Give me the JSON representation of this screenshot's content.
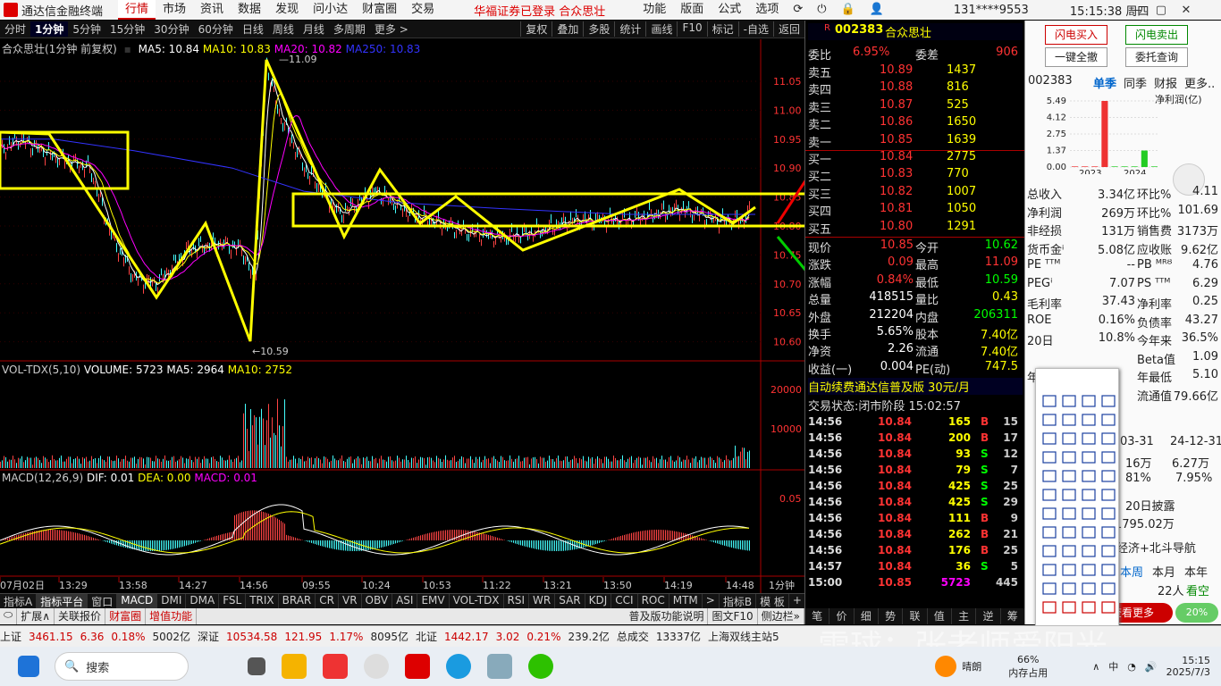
{
  "title_bar": {
    "app_name": "通达信金融终端",
    "menus": [
      "行情",
      "市场",
      "资讯",
      "数据",
      "发现",
      "问小达",
      "财富圈",
      "交易"
    ],
    "active_menu": "行情",
    "notice": "华福证券已登录  合众思壮",
    "right_menus": [
      "功能",
      "版面",
      "公式",
      "选项"
    ],
    "phone": "131****9553",
    "time": "15:15:38 周四"
  },
  "timeframes": [
    "分时",
    "1分钟",
    "5分钟",
    "15分钟",
    "30分钟",
    "60分钟",
    "日线",
    "周线",
    "月线",
    "多周期",
    "更多 >"
  ],
  "active_timeframe": "1分钟",
  "chart_tools": [
    "复权",
    "叠加",
    "多股",
    "统计",
    "画线",
    "F10",
    "标记",
    "-自选",
    "返回"
  ],
  "main_info": {
    "name": "合众思壮(1分钟 前复权)",
    "ma5": "MA5: 10.84",
    "ma10": "MA10: 10.83",
    "ma20": "MA20: 10.82",
    "ma250": "MA250: 10.83"
  },
  "vol_info": {
    "name": "VOL-TDX(5,10)",
    "volume": "VOLUME: 5723",
    "ma5": "MA5: 2964",
    "ma10": "MA10: 2752"
  },
  "macd_info": {
    "name": "MACD(12,26,9)",
    "dif": "DIF: 0.01",
    "dea": "DEA: 0.00",
    "macd": "MACD: 0.01"
  },
  "y_labels": [
    "11.05",
    "11.00",
    "10.95",
    "10.90",
    "10.85",
    "10.80",
    "10.75",
    "10.70",
    "10.65",
    "10.60"
  ],
  "vol_labels": [
    "20000",
    "10000"
  ],
  "macd_labels": [
    "0.05"
  ],
  "x_labels": [
    "07月02日",
    "13:29",
    "13:58",
    "14:27",
    "14:56",
    "09:55",
    "10:24",
    "10:53",
    "11:22",
    "13:21",
    "13:50",
    "14:19",
    "14:48"
  ],
  "high_mark": "11.09",
  "low_mark": "10.59",
  "period_label": "1分钟",
  "indicator_tabs": [
    "指标A",
    "指标平台",
    "窗口",
    "MACD",
    "DMI",
    "DMA",
    "FSL",
    "TRIX",
    "BRAR",
    "CR",
    "VR",
    "OBV",
    "ASI",
    "EMV",
    "VOL-TDX",
    "RSI",
    "WR",
    "SAR",
    "KDJ",
    "CCI",
    "ROC",
    "MTM",
    ">",
    "指标B",
    "模 板",
    "+"
  ],
  "bottom_tabs": [
    "扩展∧",
    "关联报价",
    "财富圈",
    "增值功能"
  ],
  "bottom_right": [
    "普及版功能说明",
    "图文F10",
    "侧边栏»"
  ],
  "quote": {
    "code": "002383",
    "name": "合众思壮",
    "weibi_label": "委比",
    "weibi": "6.95%",
    "weicha_label": "委差",
    "weicha": "906",
    "sell": [
      [
        "卖五",
        "10.89",
        "1437"
      ],
      [
        "卖四",
        "10.88",
        "816"
      ],
      [
        "卖三",
        "10.87",
        "525"
      ],
      [
        "卖二",
        "10.86",
        "1650"
      ],
      [
        "卖一",
        "10.85",
        "1639"
      ]
    ],
    "buy": [
      [
        "买一",
        "10.84",
        "2775"
      ],
      [
        "买二",
        "10.83",
        "770"
      ],
      [
        "买三",
        "10.82",
        "1007"
      ],
      [
        "买四",
        "10.81",
        "1050"
      ],
      [
        "买五",
        "10.80",
        "1291"
      ]
    ],
    "stats": [
      [
        "现价",
        "10.85",
        "今开",
        "10.62"
      ],
      [
        "涨跌",
        "0.09",
        "最高",
        "11.09"
      ],
      [
        "涨幅",
        "0.84%",
        "最低",
        "10.59"
      ],
      [
        "总量",
        "418515",
        "量比",
        "0.43"
      ],
      [
        "外盘",
        "212204",
        "内盘",
        "206311"
      ],
      [
        "换手",
        "5.65%",
        "股本",
        "7.40亿"
      ],
      [
        "净资",
        "2.26",
        "流通",
        "7.40亿"
      ],
      [
        "收益(一)",
        "0.004",
        "PE(动)",
        "747.5"
      ]
    ],
    "banner": "自动续费通达信普及版   30元/月",
    "trade_state": "交易状态:闭市阶段 15:02:57",
    "ticks": [
      [
        "14:56",
        "10.84",
        "165",
        "B",
        "15"
      ],
      [
        "14:56",
        "10.84",
        "200",
        "B",
        "17"
      ],
      [
        "14:56",
        "10.84",
        "93",
        "S",
        "12"
      ],
      [
        "14:56",
        "10.84",
        "79",
        "S",
        "7"
      ],
      [
        "14:56",
        "10.84",
        "425",
        "S",
        "25"
      ],
      [
        "14:56",
        "10.84",
        "425",
        "S",
        "29"
      ],
      [
        "14:56",
        "10.84",
        "111",
        "B",
        "9"
      ],
      [
        "14:56",
        "10.84",
        "262",
        "B",
        "21"
      ],
      [
        "14:56",
        "10.84",
        "176",
        "B",
        "25"
      ],
      [
        "14:57",
        "10.84",
        "36",
        "S",
        "5"
      ],
      [
        "15:00",
        "10.85",
        "5723",
        "",
        "445"
      ]
    ],
    "tabs": [
      "笔",
      "价",
      "细",
      "势",
      "联",
      "值",
      "主",
      "逆",
      "筹"
    ]
  },
  "side": {
    "btn_buy": "闪电买入",
    "btn_sell": "闪电卖出",
    "btn_allcancel": "一键全撤",
    "btn_query": "委托查询",
    "code": "002383",
    "tabs": [
      "单季",
      "同季",
      "财报",
      "更多.."
    ],
    "unit": "净利润(亿)",
    "bar_y": [
      "5.49",
      "4.12",
      "2.75",
      "1.37",
      "0.00"
    ],
    "bar_years": [
      "2023",
      "2024"
    ],
    "profit_values": [
      0.05,
      0.05,
      0.05,
      5.49,
      0.05,
      0.05,
      0.05,
      1.37,
      0.05
    ],
    "rows": [
      [
        "总收入",
        "3.34亿",
        "环比%",
        "4.11"
      ],
      [
        "净利润",
        "269万",
        "环比%",
        "101.69"
      ],
      [
        "非经损",
        "131万",
        "销售费",
        "3173万"
      ],
      [
        "货币金ⁱ",
        "5.08亿",
        "应收账",
        "9.62亿"
      ],
      [
        "PE ᵀᵀᴹ",
        "--",
        "PB ᴹᴿᴽ",
        "4.76"
      ],
      [
        "PEGⁱ",
        "7.07",
        "PS ᵀᵀᴹ",
        "6.29"
      ],
      [
        "毛利率",
        "37.43",
        "净利率",
        "0.25"
      ],
      [
        "ROE",
        "0.16%",
        "负债率",
        "43.27"
      ],
      [
        "20日",
        "10.8%",
        "今年来",
        "36.5%"
      ],
      [
        "",
        "",
        "Beta值",
        "1.09"
      ],
      [
        "年",
        "",
        "年最低",
        "5.10"
      ],
      [
        "",
        "",
        "流通值",
        "79.66亿"
      ]
    ],
    "extra": [
      "03-31",
      "24-12-31",
      "16万",
      "6.27万",
      "81%",
      "7.95%",
      "20日披露",
      "1795.02万",
      "经济+北斗导航"
    ],
    "period_tabs": [
      "本周",
      "本月",
      "本年"
    ],
    "people": "22人",
    "watch": "看空",
    "bottom_btn": "查看更多",
    "pct": "20%"
  },
  "status": {
    "sh_label": "上证",
    "sh": "3461.15",
    "sh_chg": "6.36",
    "sh_pct": "0.18%",
    "sh_amt": "5002亿",
    "sz_label": "深证",
    "sz": "10534.58",
    "sz_chg": "121.95",
    "sz_pct": "1.17%",
    "sz_amt": "8095亿",
    "bz_label": "北证",
    "bz": "1442.17",
    "bz_chg": "3.02",
    "bz_pct": "0.21%",
    "bz_amt": "239.2亿",
    "total_label": "总成交",
    "total": "13337亿",
    "server": "上海双线主站5"
  },
  "taskbar": {
    "search": "搜索",
    "weather": "晴朗",
    "mem": "66%",
    "mem_label": "内存占用",
    "time": "15:15",
    "date": "2025/7/3",
    "lang": "中"
  },
  "watermark": "雪球：张老师爱阳光"
}
